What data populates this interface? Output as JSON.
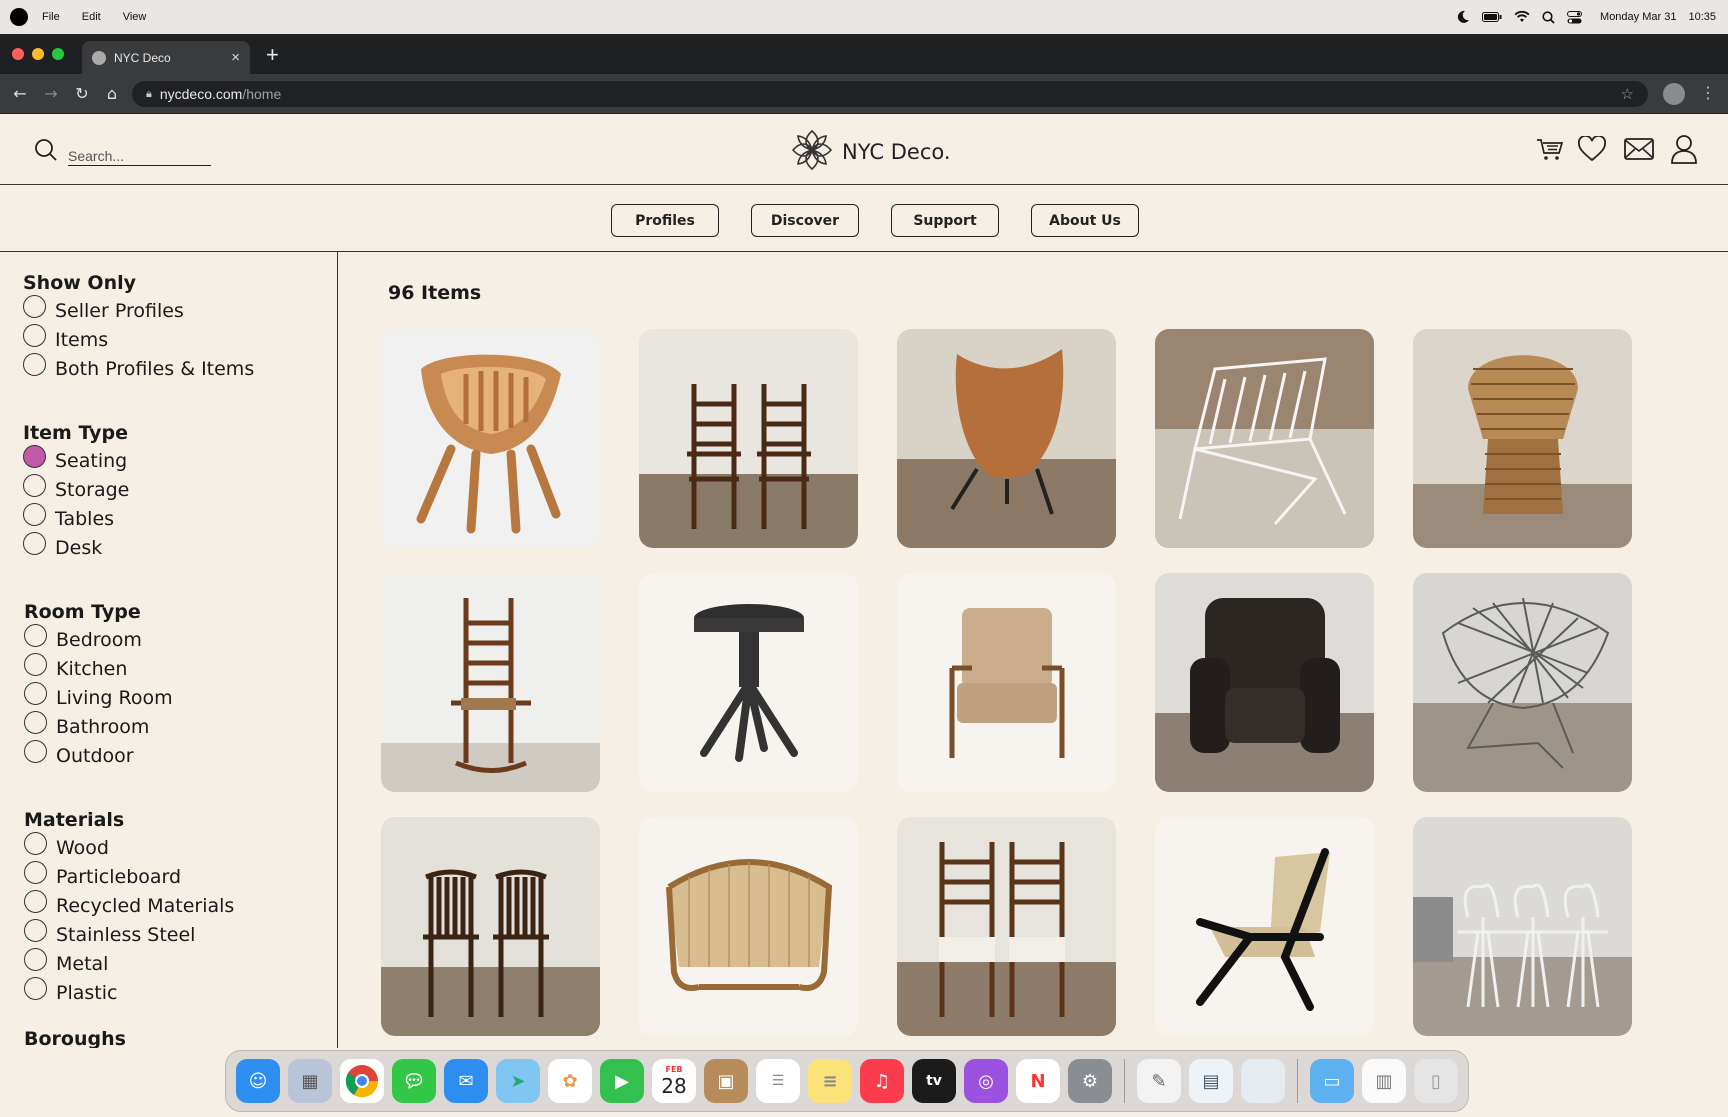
{
  "menubar": {
    "items": [
      "File",
      "Edit",
      "View"
    ],
    "datetime_date": "Monday Mar 31",
    "datetime_time": "10:35"
  },
  "browser": {
    "tab_title": "NYC Deco",
    "url_host": "nycdeco.com",
    "url_path": "/home"
  },
  "header": {
    "search_placeholder": "Search...",
    "brand_name": "NYC Deco."
  },
  "nav": {
    "buttons": [
      "Profiles",
      "Discover",
      "Support",
      "About Us"
    ]
  },
  "sidebar": {
    "show_only": {
      "title": "Show Only",
      "options": [
        "Seller Profiles",
        "Items",
        "Both Profiles & Items"
      ]
    },
    "item_type": {
      "title": "Item Type",
      "options": [
        "Seating",
        "Storage",
        "Tables",
        "Desk"
      ],
      "selected": "Seating"
    },
    "room_type": {
      "title": "Room Type",
      "options": [
        "Bedroom",
        "Kitchen",
        "Living Room",
        "Bathroom",
        "Outdoor"
      ]
    },
    "materials": {
      "title": "Materials",
      "options": [
        "Wood",
        "Particleboard",
        "Recycled Materials",
        "Stainless Steel",
        "Metal",
        "Plastic"
      ]
    },
    "boroughs": {
      "title": "Boroughs"
    }
  },
  "main": {
    "item_count": "96 Items",
    "products": [
      {
        "name": "sculpted-wood-armchair"
      },
      {
        "name": "pair-ladderback-armchairs"
      },
      {
        "name": "leather-butterfly-chair"
      },
      {
        "name": "white-wire-lounge-chair"
      },
      {
        "name": "wicker-peacock-chair"
      },
      {
        "name": "ladderback-rocking-chair"
      },
      {
        "name": "swivel-piano-stool"
      },
      {
        "name": "upholstered-wood-armchair"
      },
      {
        "name": "black-leather-club-chair"
      },
      {
        "name": "wire-diamond-chair"
      },
      {
        "name": "pair-windsor-chairs"
      },
      {
        "name": "rattan-lounge-chair"
      },
      {
        "name": "pair-ladderback-side-chairs"
      },
      {
        "name": "cane-lounge-chair"
      },
      {
        "name": "ice-cream-parlor-chairs"
      }
    ]
  },
  "dock": {
    "calendar_month": "FEB",
    "calendar_day": "28",
    "apps": [
      "finder-icon",
      "launchpad-icon",
      "chrome-icon",
      "messages-icon",
      "mail-icon",
      "maps-icon",
      "photos-icon",
      "facetime-icon",
      "calendar-icon",
      "contacts-icon",
      "reminders-icon",
      "notes-icon",
      "music-icon",
      "tv-icon",
      "podcasts-icon",
      "news-icon",
      "settings-icon",
      "textedit-icon",
      "preview-icon",
      "blank-app-icon",
      "folder-icon",
      "document-icon",
      "trash-icon"
    ]
  }
}
